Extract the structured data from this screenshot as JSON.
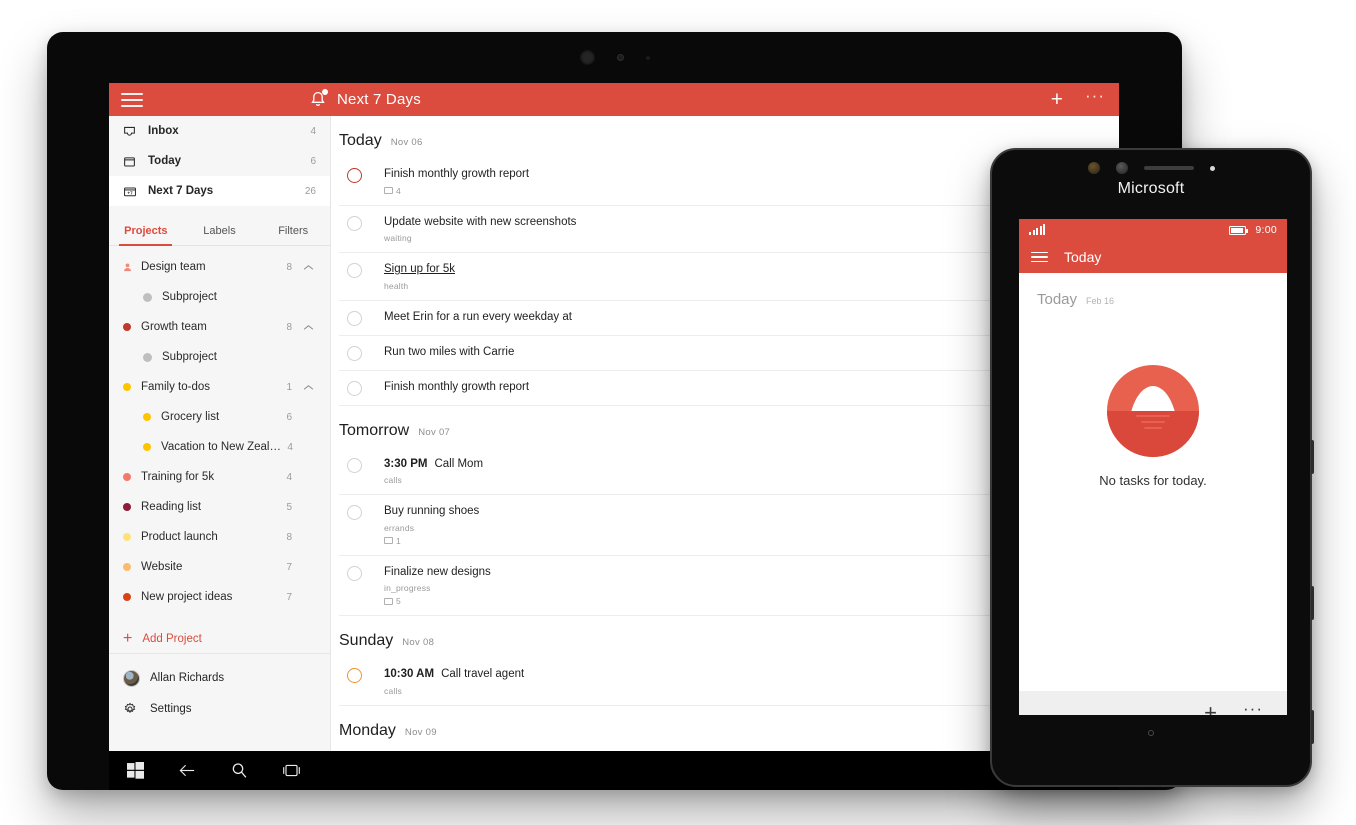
{
  "colors": {
    "brand_red": "#DB4C3F",
    "sidebar_bg": "#F6F6F6",
    "priority_1": "#C0392B",
    "priority_3": "#F0922B"
  },
  "tablet": {
    "app_header": {
      "menu_icon": "hamburger-icon",
      "bell_icon": "bell-notification-icon",
      "title": "Next 7 Days",
      "add_label": "+",
      "more_label": "···"
    },
    "sidebar": {
      "nav": [
        {
          "icon": "inbox-icon",
          "label": "Inbox",
          "count": "4",
          "active": false
        },
        {
          "icon": "today-icon",
          "label": "Today",
          "count": "6",
          "active": false
        },
        {
          "icon": "next7-icon",
          "label": "Next 7 Days",
          "count": "26",
          "active": true
        }
      ],
      "tabs": [
        {
          "label": "Projects",
          "active": true
        },
        {
          "label": "Labels",
          "active": false
        },
        {
          "label": "Filters",
          "active": false
        }
      ],
      "projects": [
        {
          "label": "Design team",
          "count": "8",
          "color": "#F08A7A",
          "level": 0,
          "chevron": true,
          "icon": "person-shared-icon"
        },
        {
          "label": "Subproject",
          "count": "",
          "color": "#BFBFBF",
          "level": 1,
          "chevron": false,
          "icon": "dot-icon"
        },
        {
          "label": "Growth team",
          "count": "8",
          "color": "#C0392B",
          "level": 0,
          "chevron": true,
          "icon": "dot-icon"
        },
        {
          "label": "Subproject",
          "count": "",
          "color": "#BFBFBF",
          "level": 1,
          "chevron": false,
          "icon": "dot-icon"
        },
        {
          "label": "Family to-dos",
          "count": "1",
          "color": "#FFC400",
          "level": 0,
          "chevron": true,
          "icon": "dot-icon"
        },
        {
          "label": "Grocery list",
          "count": "6",
          "color": "#FFC400",
          "level": 1,
          "chevron": false,
          "icon": "dot-icon"
        },
        {
          "label": "Vacation to New Zealand",
          "count": "4",
          "color": "#FFC400",
          "level": 1,
          "chevron": false,
          "icon": "dot-icon"
        },
        {
          "label": "Training for 5k",
          "count": "4",
          "color": "#F4796B",
          "level": 0,
          "chevron": false,
          "icon": "dot-icon"
        },
        {
          "label": "Reading list",
          "count": "5",
          "color": "#8E1C3B",
          "level": 0,
          "chevron": false,
          "icon": "dot-icon"
        },
        {
          "label": "Product launch",
          "count": "8",
          "color": "#FDE27A",
          "level": 0,
          "chevron": false,
          "icon": "dot-icon"
        },
        {
          "label": "Website",
          "count": "7",
          "color": "#FBBB6E",
          "level": 0,
          "chevron": false,
          "icon": "dot-icon"
        },
        {
          "label": "New project ideas",
          "count": "7",
          "color": "#D84315",
          "level": 0,
          "chevron": false,
          "icon": "dot-icon"
        }
      ],
      "add_project": "Add Project",
      "user": "Allan Richards",
      "settings": "Settings"
    },
    "tasklist": {
      "groups": [
        {
          "day": "Today",
          "date": "Nov 06",
          "tasks": [
            {
              "time": "",
              "title": "Finish monthly growth report",
              "label": "",
              "notes": "4",
              "priority": "p1",
              "underline": false
            },
            {
              "time": "",
              "title": "Update website with new screenshots",
              "label": "waiting",
              "notes": "",
              "priority": "",
              "underline": false
            },
            {
              "time": "",
              "title": "Sign up for 5k",
              "label": "health",
              "notes": "",
              "priority": "",
              "underline": true
            },
            {
              "time": "",
              "title": "Meet Erin for a run every weekday at",
              "label": "",
              "notes": "",
              "priority": "",
              "underline": false
            },
            {
              "time": "",
              "title": "Run two miles with Carrie",
              "label": "",
              "notes": "",
              "priority": "",
              "underline": false
            },
            {
              "time": "",
              "title": "Finish monthly growth report",
              "label": "",
              "notes": "",
              "priority": "",
              "underline": false
            }
          ]
        },
        {
          "day": "Tomorrow",
          "date": "Nov 07",
          "tasks": [
            {
              "time": "3:30 PM",
              "title": "Call Mom",
              "label": "calls",
              "notes": "",
              "priority": "",
              "underline": false
            },
            {
              "time": "",
              "title": "Buy running shoes",
              "label": "errands",
              "notes": "1",
              "priority": "",
              "underline": false
            },
            {
              "time": "",
              "title": "Finalize new designs",
              "label": "in_progress",
              "notes": "5",
              "priority": "",
              "underline": false
            }
          ]
        },
        {
          "day": "Sunday",
          "date": "Nov 08",
          "tasks": [
            {
              "time": "10:30 AM",
              "title": "Call travel agent",
              "label": "calls",
              "notes": "",
              "priority": "p3",
              "underline": false
            }
          ]
        },
        {
          "day": "Monday",
          "date": "Nov 09",
          "tasks": []
        }
      ]
    },
    "taskbar": {
      "start_icon": "windows-start-icon",
      "back_icon": "back-arrow-icon",
      "search_icon": "search-icon",
      "taskview_icon": "task-view-icon",
      "battery_icon": "battery-icon",
      "wifi_icon": "wifi-icon"
    }
  },
  "phone": {
    "brand": "Microsoft",
    "status": {
      "signal_icon": "signal-bars-icon",
      "battery_icon": "battery-icon",
      "time": "9:00"
    },
    "appbar": {
      "menu_icon": "hamburger-icon",
      "title": "Today"
    },
    "content": {
      "day_name": "Today",
      "day_date": "Feb 16",
      "empty_icon": "sunrise-icon",
      "empty_text": "No tasks for today."
    },
    "bottombar": {
      "add_label": "+",
      "more_label": "···"
    }
  }
}
